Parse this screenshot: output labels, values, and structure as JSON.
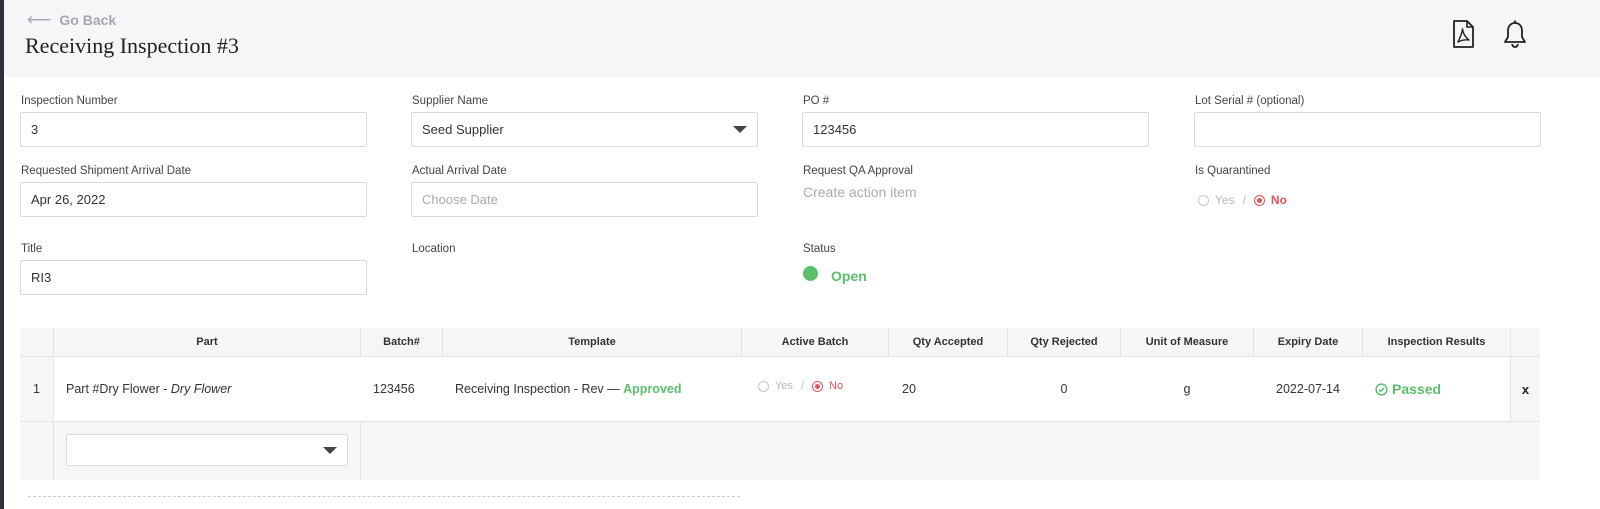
{
  "header": {
    "go_back": "Go Back",
    "title": "Receiving Inspection #3",
    "icons": [
      "pdf-icon",
      "bell-icon"
    ]
  },
  "form": {
    "inspection_number": {
      "label": "Inspection Number",
      "value": "3"
    },
    "supplier_name": {
      "label": "Supplier Name",
      "value": "Seed Supplier"
    },
    "po_number": {
      "label": "PO #",
      "value": "123456"
    },
    "lot_serial": {
      "label": "Lot Serial # (optional)",
      "value": ""
    },
    "requested_arrival": {
      "label": "Requested Shipment Arrival Date",
      "value": "Apr 26, 2022"
    },
    "actual_arrival": {
      "label": "Actual Arrival Date",
      "placeholder": "Choose Date"
    },
    "qa_approval": {
      "label": "Request QA Approval",
      "action": "Create action item"
    },
    "quarantined": {
      "label": "Is Quarantined",
      "yes": "Yes",
      "separator": "/",
      "no": "No",
      "selected": "No"
    },
    "title": {
      "label": "Title",
      "value": "RI3"
    },
    "location": {
      "label": "Location"
    },
    "status": {
      "label": "Status",
      "value": "Open",
      "color": "#5bbf6b"
    }
  },
  "table": {
    "columns": [
      "Part",
      "Batch#",
      "Template",
      "Active Batch",
      "Qty Accepted",
      "Qty Rejected",
      "Unit of Measure",
      "Expiry Date",
      "Inspection Results"
    ],
    "rows": [
      {
        "index": "1",
        "part_prefix": "Part #Dry Flower - ",
        "part_name": "Dry Flower",
        "batch": "123456",
        "template": "Receiving Inspection - Rev — ",
        "template_status": "Approved",
        "active_yes": "Yes",
        "active_sep": "/",
        "active_no": "No",
        "qty_accepted": "20",
        "qty_rejected": "0",
        "unit": "g",
        "expiry": "2022-07-14",
        "result": "Passed",
        "remove": "x"
      }
    ]
  },
  "colors": {
    "accent_green": "#5bbf6b",
    "accent_red": "#e6535a",
    "text_muted": "#a8abb1"
  }
}
